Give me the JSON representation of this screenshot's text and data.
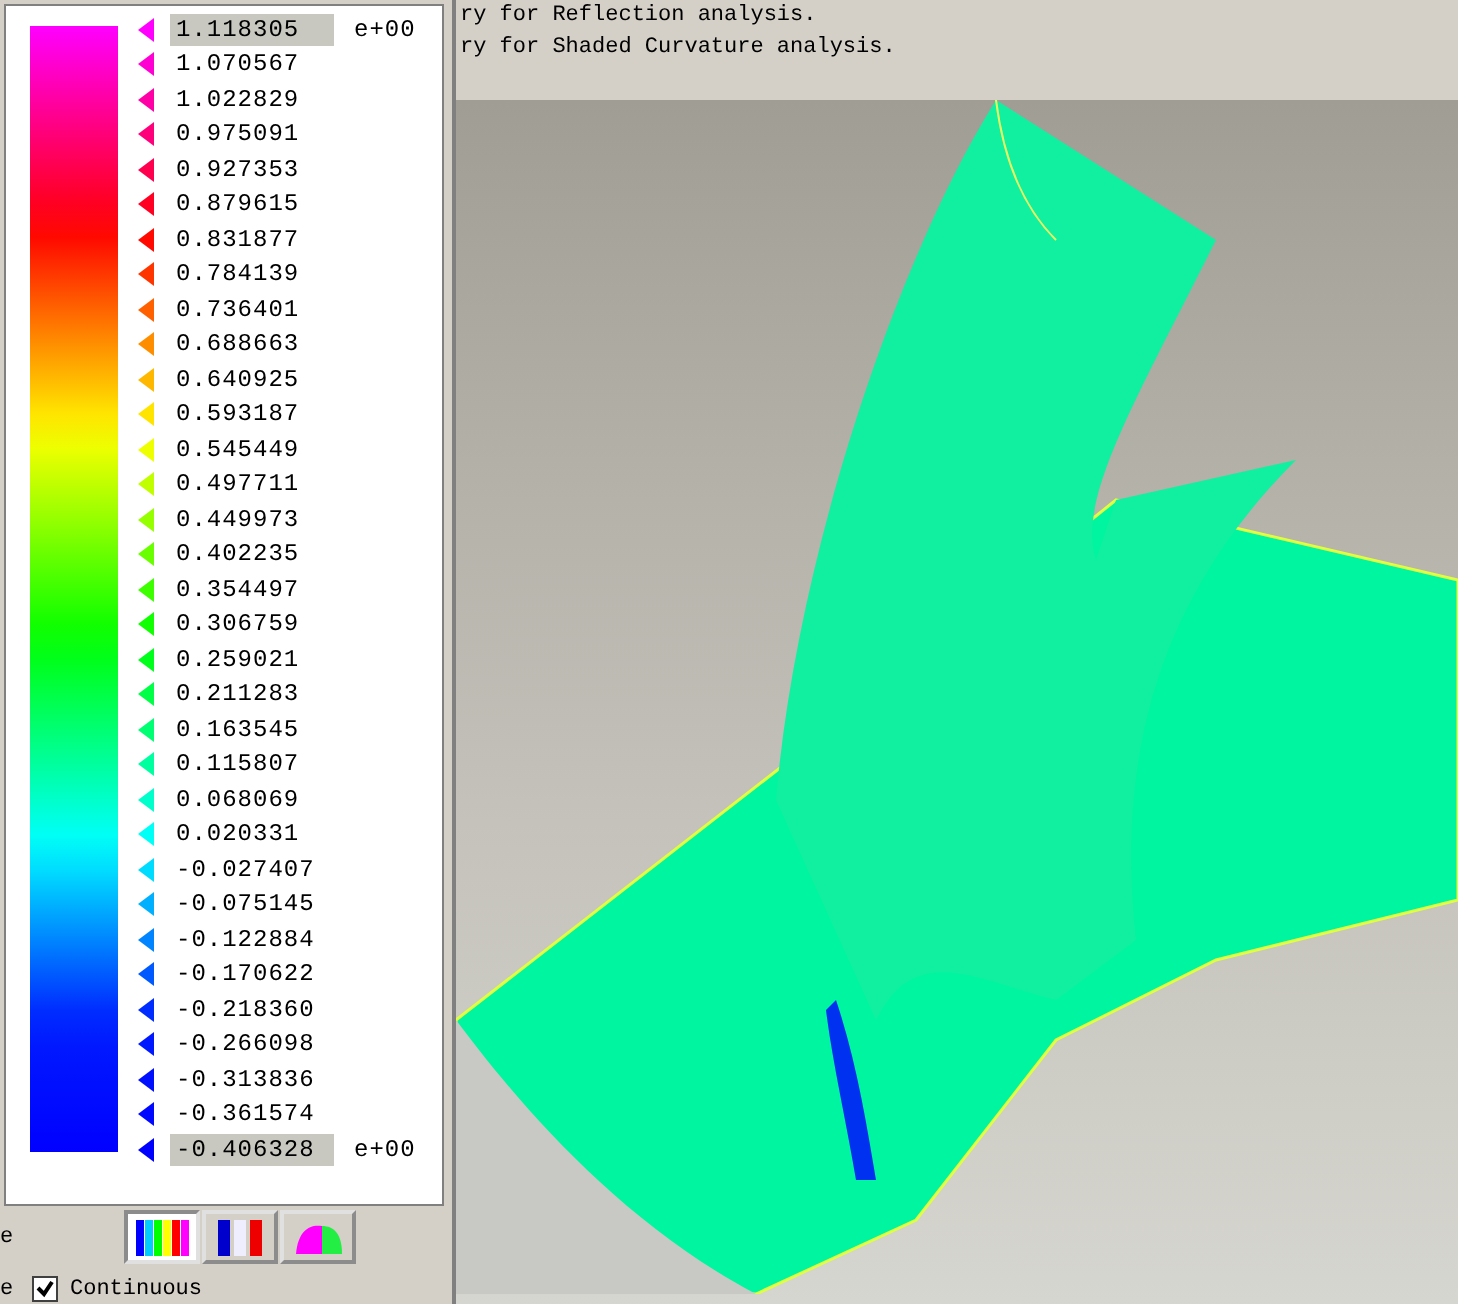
{
  "legend": {
    "rows": [
      {
        "kind": "field",
        "value": "1.118305",
        "exponent": "e+00",
        "color": "#ff00ff"
      },
      {
        "kind": "label",
        "value": "1.070567",
        "color": "#ff00d3"
      },
      {
        "kind": "label",
        "value": "1.022829",
        "color": "#ff00a7"
      },
      {
        "kind": "label",
        "value": "0.975091",
        "color": "#ff007b"
      },
      {
        "kind": "label",
        "value": "0.927353",
        "color": "#ff004f"
      },
      {
        "kind": "label",
        "value": "0.879615",
        "color": "#ff0023"
      },
      {
        "kind": "label",
        "value": "0.831877",
        "color": "#ff0900"
      },
      {
        "kind": "label",
        "value": "0.784139",
        "color": "#ff3500"
      },
      {
        "kind": "label",
        "value": "0.736401",
        "color": "#ff6100"
      },
      {
        "kind": "label",
        "value": "0.688663",
        "color": "#ff8d00"
      },
      {
        "kind": "label",
        "value": "0.640925",
        "color": "#ffb800"
      },
      {
        "kind": "label",
        "value": "0.593187",
        "color": "#ffe400"
      },
      {
        "kind": "label",
        "value": "0.545449",
        "color": "#edff00"
      },
      {
        "kind": "label",
        "value": "0.497711",
        "color": "#c1ff00"
      },
      {
        "kind": "label",
        "value": "0.449973",
        "color": "#96ff00"
      },
      {
        "kind": "label",
        "value": "0.402235",
        "color": "#69ff00"
      },
      {
        "kind": "label",
        "value": "0.354497",
        "color": "#3dff00"
      },
      {
        "kind": "label",
        "value": "0.306759",
        "color": "#11ff00"
      },
      {
        "kind": "label",
        "value": "0.259021",
        "color": "#00ff1a"
      },
      {
        "kind": "label",
        "value": "0.211283",
        "color": "#00ff46"
      },
      {
        "kind": "label",
        "value": "0.163545",
        "color": "#00ff72"
      },
      {
        "kind": "label",
        "value": "0.115807",
        "color": "#00ff9e"
      },
      {
        "kind": "label",
        "value": "0.068069",
        "color": "#00ffca"
      },
      {
        "kind": "label",
        "value": "0.020331",
        "color": "#00fff6"
      },
      {
        "kind": "label",
        "value": "-0.027407",
        "color": "#00dcff"
      },
      {
        "kind": "label",
        "value": "-0.075145",
        "color": "#00b0ff"
      },
      {
        "kind": "label",
        "value": "-0.122884",
        "color": "#0084ff"
      },
      {
        "kind": "label",
        "value": "-0.170622",
        "color": "#0058ff"
      },
      {
        "kind": "label",
        "value": "-0.218360",
        "color": "#002cff"
      },
      {
        "kind": "label",
        "value": "-0.266098",
        "color": "#0018ff"
      },
      {
        "kind": "label",
        "value": "-0.313836",
        "color": "#0010ff"
      },
      {
        "kind": "label",
        "value": "-0.361574",
        "color": "#0008ff"
      },
      {
        "kind": "field",
        "value": "-0.406328",
        "exponent": "e+00",
        "color": "#0000ff"
      }
    ]
  },
  "controls": {
    "scale_label": "e",
    "modes": [
      {
        "kind": "spectrum",
        "selected": true
      },
      {
        "kind": "tricolor",
        "selected": false
      },
      {
        "kind": "surface",
        "selected": false
      }
    ],
    "continuous": {
      "label_cut": "e",
      "label": "Continuous",
      "checked": true
    }
  },
  "messages": [
    "ry for Reflection analysis.",
    "ry for Shaded Curvature analysis."
  ]
}
